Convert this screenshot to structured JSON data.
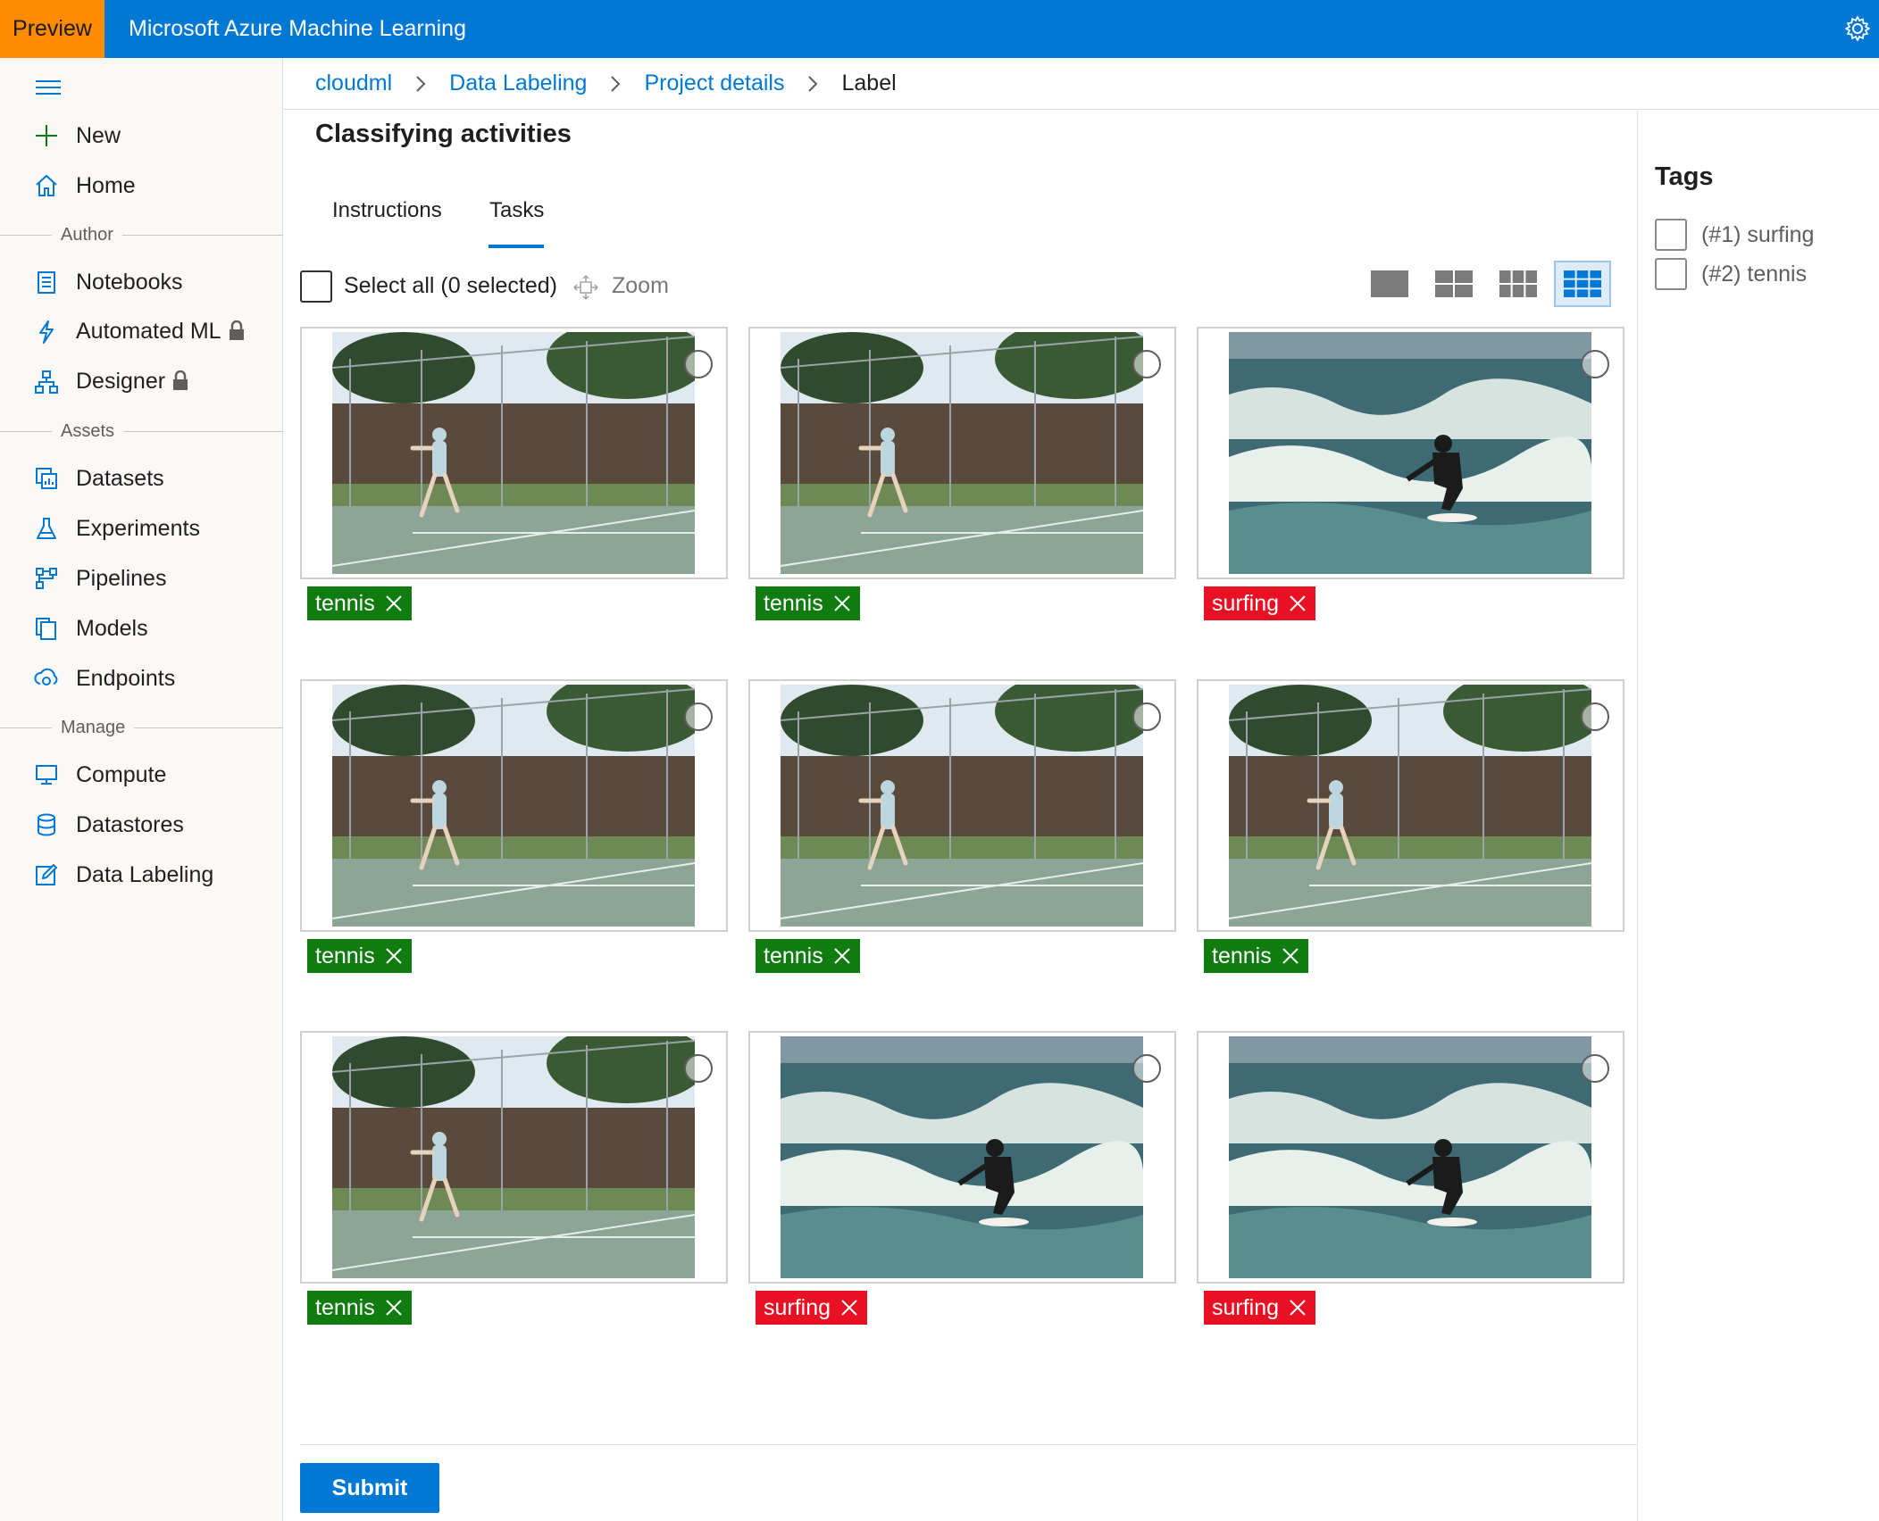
{
  "topbar": {
    "preview_label": "Preview",
    "app_title": "Microsoft Azure Machine Learning",
    "settings_icon": "gear-icon"
  },
  "nav": {
    "menu_icon": "hamburger-icon",
    "top_items": [
      {
        "label": "New",
        "icon": "plus-icon"
      },
      {
        "label": "Home",
        "icon": "home-icon"
      }
    ],
    "sections": {
      "author": "Author",
      "assets": "Assets",
      "manage": "Manage"
    },
    "author_items": [
      {
        "label": "Notebooks",
        "icon": "notebook-icon",
        "locked": false
      },
      {
        "label": "Automated ML",
        "icon": "automl-icon",
        "locked": true
      },
      {
        "label": "Designer",
        "icon": "designer-icon",
        "locked": true
      }
    ],
    "assets_items": [
      {
        "label": "Datasets",
        "icon": "datasets-icon"
      },
      {
        "label": "Experiments",
        "icon": "flask-icon"
      },
      {
        "label": "Pipelines",
        "icon": "pipelines-icon"
      },
      {
        "label": "Models",
        "icon": "models-icon"
      },
      {
        "label": "Endpoints",
        "icon": "endpoints-icon"
      }
    ],
    "manage_items": [
      {
        "label": "Compute",
        "icon": "monitor-icon"
      },
      {
        "label": "Datastores",
        "icon": "database-icon"
      },
      {
        "label": "Data Labeling",
        "icon": "edit-icon"
      }
    ]
  },
  "breadcrumb": {
    "items": [
      "cloudml",
      "Data Labeling",
      "Project details",
      "Label"
    ]
  },
  "page": {
    "title": "Classifying activities",
    "tabs": [
      "Instructions",
      "Tasks"
    ],
    "active_tab": "Tasks",
    "select_all_label": "Select all (0 selected)",
    "zoom_label": "Zoom",
    "view_modes": [
      "1-up",
      "2-up",
      "3-up",
      "6-up"
    ],
    "active_view": "6-up"
  },
  "images": [
    {
      "scene": "tennis",
      "tag": "tennis",
      "tag_color": "#107c10"
    },
    {
      "scene": "tennis",
      "tag": "tennis",
      "tag_color": "#107c10"
    },
    {
      "scene": "surfing",
      "tag": "surfing",
      "tag_color": "#e81123"
    },
    {
      "scene": "tennis",
      "tag": "tennis",
      "tag_color": "#107c10"
    },
    {
      "scene": "tennis",
      "tag": "tennis",
      "tag_color": "#107c10"
    },
    {
      "scene": "tennis",
      "tag": "tennis",
      "tag_color": "#107c10"
    },
    {
      "scene": "tennis",
      "tag": "tennis",
      "tag_color": "#107c10"
    },
    {
      "scene": "surfing",
      "tag": "surfing",
      "tag_color": "#e81123"
    },
    {
      "scene": "surfing",
      "tag": "surfing",
      "tag_color": "#e81123"
    }
  ],
  "submit_label": "Submit",
  "tags_panel": {
    "title": "Tags",
    "options": [
      "(#1) surfing",
      "(#2) tennis"
    ]
  },
  "colors": {
    "accent": "#0078d4",
    "preview": "#ff8c00",
    "tennis_tag": "#107c10",
    "surfing_tag": "#e81123"
  }
}
